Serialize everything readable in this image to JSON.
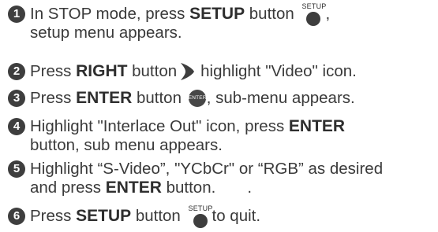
{
  "steps": [
    {
      "number": "1",
      "parts": {
        "a": "In STOP mode, press ",
        "b": "SETUP",
        "c": " button ",
        "d": ",",
        "line2": "setup menu appears."
      },
      "button_caption": "SETUP",
      "icon": "setup-button-icon"
    },
    {
      "number": "2",
      "parts": {
        "a": "Press ",
        "b": "RIGHT",
        "c": " button",
        "d": "highlight \"Video\" icon."
      },
      "icon": "right-arrow-button-icon"
    },
    {
      "number": "3",
      "parts": {
        "a": "Press ",
        "b": "ENTER",
        "c": " button ",
        "d": ", sub-menu appears."
      },
      "button_caption": "ENTER",
      "icon": "enter-button-icon"
    },
    {
      "number": "4",
      "parts": {
        "a": "Highlight \"Interlace Out\" icon, press ",
        "b": "ENTER",
        "line2": "button, sub menu appears."
      }
    },
    {
      "number": "5",
      "parts": {
        "a": "Highlight “S-Video”, \"YCbCr\" or “RGB” as desired",
        "line2a": "and press ",
        "line2b": "ENTER",
        "line2c": " button.",
        "dot": "."
      }
    },
    {
      "number": "6",
      "parts": {
        "a": "Press ",
        "b": "SETUP",
        "c": " button ",
        "d": "to quit."
      },
      "button_caption": "SETUP",
      "icon": "setup-button-icon"
    }
  ],
  "colors": {
    "text": "#3a3a3a",
    "bullet": "#3e3e3e",
    "button": "#3e3e3e"
  }
}
